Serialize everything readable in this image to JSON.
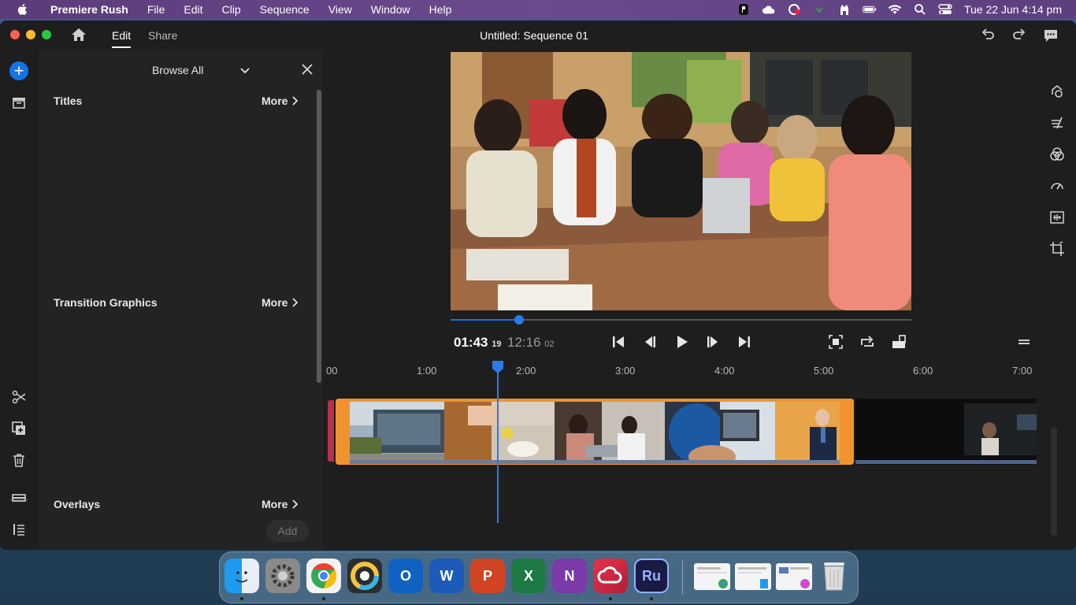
{
  "menubar": {
    "app_name": "Premiere Rush",
    "items": [
      "File",
      "Edit",
      "Clip",
      "Sequence",
      "View",
      "Window",
      "Help"
    ],
    "clock": "Tue 22 Jun  4:14 pm",
    "status_icons": [
      "app-indicator-icon",
      "cloud-icon",
      "creative-cloud-icon",
      "extension-icon",
      "utility-icon",
      "battery-icon",
      "wifi-icon",
      "search-icon",
      "control-center-icon"
    ]
  },
  "window": {
    "tabs": {
      "edit": "Edit",
      "share": "Share"
    },
    "title": "Untitled: Sequence 01"
  },
  "browse_panel": {
    "title": "Browse All",
    "sections": [
      {
        "title": "Titles",
        "more": "More"
      },
      {
        "title": "Transition Graphics",
        "more": "More"
      },
      {
        "title": "Overlays",
        "more": "More"
      }
    ],
    "add_label": "Add"
  },
  "player": {
    "current_time": "01:43",
    "current_frames": "19",
    "duration_time": "12:16",
    "duration_frames": "02",
    "playhead_fraction": 0.14
  },
  "timeline": {
    "ruler": [
      "00",
      "1:00",
      "2:00",
      "3:00",
      "4:00",
      "5:00",
      "6:00",
      "7:00"
    ]
  },
  "dock": {
    "apps": [
      "Finder",
      "System Preferences",
      "Google Chrome",
      "Chrome Canary",
      "Outlook",
      "Word",
      "PowerPoint",
      "Excel",
      "OneNote",
      "Creative Cloud",
      "Premiere Rush"
    ],
    "labels": {
      "outlook": "O",
      "word": "W",
      "powerpoint": "P",
      "excel": "X",
      "onenote": "N",
      "rush": "Ru"
    }
  },
  "colors": {
    "accent": "#1473e6",
    "clip_selected": "#f0932e",
    "clip_handle": "#b8304f"
  }
}
